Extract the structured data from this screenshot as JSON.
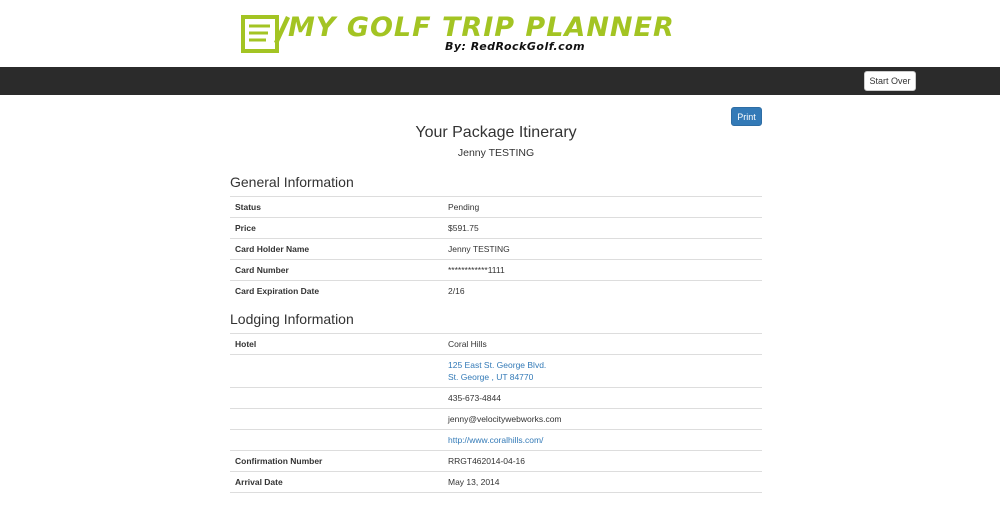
{
  "header": {
    "logo_title": "My Golf Trip Planner",
    "logo_sub": "By: RedRockGolf.com",
    "brand_color": "#a3c423"
  },
  "nav": {
    "start_over_label": "Start Over"
  },
  "main": {
    "print_label": "Print",
    "title": "Your Package Itinerary",
    "subtitle": "Jenny TESTING"
  },
  "general": {
    "heading": "General Information",
    "rows": [
      {
        "label": "Status",
        "value": "Pending"
      },
      {
        "label": "Price",
        "value": "$591.75"
      },
      {
        "label": "Card Holder Name",
        "value": "Jenny TESTING"
      },
      {
        "label": "Card Number",
        "value": "************1111"
      },
      {
        "label": "Card Expiration Date",
        "value": "2/16"
      }
    ]
  },
  "lodging": {
    "heading": "Lodging Information",
    "hotel_label": "Hotel",
    "hotel_name": "Coral Hills",
    "address_line1": "125 East St. George Blvd.",
    "address_line2": "St. George , UT 84770",
    "phone": "435-673-4844",
    "email": "jenny@velocitywebworks.com",
    "website": "http://www.coralhills.com/",
    "confirmation_label": "Confirmation Number",
    "confirmation_value": "RRGT462014-04-16",
    "arrival_label": "Arrival Date",
    "arrival_value": "May 13, 2014"
  }
}
